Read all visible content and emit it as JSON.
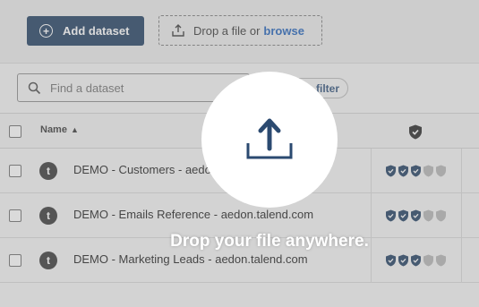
{
  "toolbar": {
    "add_label": "Add dataset",
    "drop_text": "Drop a file or",
    "browse_label": "browse"
  },
  "search": {
    "placeholder": "Find a dataset"
  },
  "filter_label": "filter",
  "table": {
    "header_name": "Name",
    "rows": [
      {
        "avatar": "t",
        "name": "DEMO - Customers - aedon.talend.com",
        "quality": 3
      },
      {
        "avatar": "t",
        "name": "DEMO - Emails Reference - aedon.talend.com",
        "quality": 3
      },
      {
        "avatar": "t",
        "name": "DEMO - Marketing Leads - aedon.talend.com",
        "quality": 3
      }
    ]
  },
  "overlay": {
    "message": "Drop your file anywhere."
  },
  "colors": {
    "primary": "#1d3b5f",
    "link": "#1d5fb8",
    "shield_active": "#1d3b5f",
    "shield_inactive": "#b4b4b4"
  }
}
